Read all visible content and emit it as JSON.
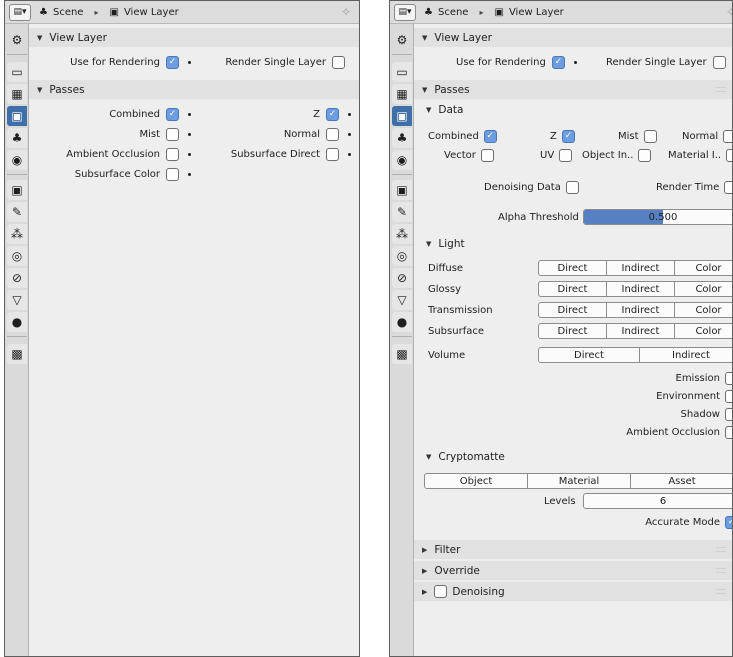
{
  "header": {
    "breadcrumb_scene": "Scene",
    "breadcrumb_view_layer": "View Layer"
  },
  "colors": {
    "accent": "#3f6ea8",
    "checkbox_checked": "#6b9de0",
    "slider_fill": "#5680c2"
  },
  "left_panel": {
    "view_layer": {
      "title": "View Layer",
      "use_for_rendering": {
        "label": "Use for Rendering",
        "checked": true
      },
      "render_single_layer": {
        "label": "Render Single Layer",
        "checked": false
      }
    },
    "passes": {
      "title": "Passes",
      "combined": {
        "label": "Combined",
        "checked": true
      },
      "z": {
        "label": "Z",
        "checked": true
      },
      "mist": {
        "label": "Mist",
        "checked": false
      },
      "normal": {
        "label": "Normal",
        "checked": false
      },
      "ambient_occlusion": {
        "label": "Ambient Occlusion",
        "checked": false
      },
      "subsurface_direct": {
        "label": "Subsurface Direct",
        "checked": false
      },
      "subsurface_color": {
        "label": "Subsurface Color",
        "checked": false
      }
    }
  },
  "right_panel": {
    "view_layer": {
      "title": "View Layer",
      "use_for_rendering": {
        "label": "Use for Rendering",
        "checked": true
      },
      "render_single_layer": {
        "label": "Render Single Layer",
        "checked": false
      }
    },
    "passes_title": "Passes",
    "data": {
      "title": "Data",
      "combined": {
        "label": "Combined",
        "checked": true
      },
      "z": {
        "label": "Z",
        "checked": true
      },
      "mist": {
        "label": "Mist",
        "checked": false
      },
      "normal": {
        "label": "Normal",
        "checked": false
      },
      "vector": {
        "label": "Vector",
        "checked": false
      },
      "uv": {
        "label": "UV",
        "checked": false
      },
      "object_index": {
        "label": "Object In..",
        "checked": false
      },
      "material_index": {
        "label": "Material I..",
        "checked": false
      },
      "denoising_data": {
        "label": "Denoising Data",
        "checked": false
      },
      "render_time": {
        "label": "Render Time",
        "checked": false
      },
      "alpha_threshold": {
        "label": "Alpha Threshold",
        "value": "0.500",
        "fraction": 0.5
      }
    },
    "light": {
      "title": "Light",
      "rows": [
        {
          "label": "Diffuse",
          "buttons": [
            "Direct",
            "Indirect",
            "Color"
          ]
        },
        {
          "label": "Glossy",
          "buttons": [
            "Direct",
            "Indirect",
            "Color"
          ]
        },
        {
          "label": "Transmission",
          "buttons": [
            "Direct",
            "Indirect",
            "Color"
          ]
        },
        {
          "label": "Subsurface",
          "buttons": [
            "Direct",
            "Indirect",
            "Color"
          ]
        }
      ],
      "volume": {
        "label": "Volume",
        "buttons": [
          "Direct",
          "Indirect"
        ]
      },
      "emission": {
        "label": "Emission",
        "checked": false
      },
      "environment": {
        "label": "Environment",
        "checked": false
      },
      "shadow": {
        "label": "Shadow",
        "checked": false
      },
      "ambient_occlusion": {
        "label": "Ambient Occlusion",
        "checked": false
      }
    },
    "cryptomatte": {
      "title": "Cryptomatte",
      "buttons": [
        "Object",
        "Material",
        "Asset"
      ],
      "levels": {
        "label": "Levels",
        "value": "6"
      },
      "accurate_mode": {
        "label": "Accurate Mode",
        "checked": true
      }
    },
    "filter_title": "Filter",
    "override_title": "Override",
    "denoising": {
      "label": "Denoising",
      "checked": false
    }
  }
}
